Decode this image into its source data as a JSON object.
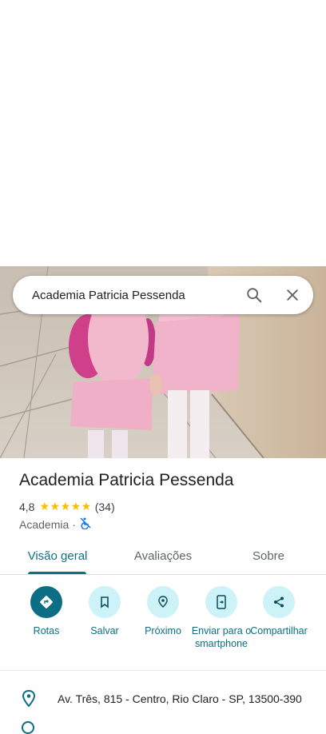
{
  "search": {
    "query": "Academia Patricia Pessenda"
  },
  "place": {
    "name": "Academia Patricia Pessenda",
    "rating": "4,8",
    "stars": "★★★★★",
    "reviews_count": "(34)",
    "category": "Academia",
    "separator": "·"
  },
  "tabs": [
    {
      "label": "Visão geral",
      "active": true
    },
    {
      "label": "Avaliações",
      "active": false
    },
    {
      "label": "Sobre",
      "active": false
    }
  ],
  "actions": [
    {
      "label": "Rotas",
      "icon": "directions-icon"
    },
    {
      "label": "Salvar",
      "icon": "bookmark-icon"
    },
    {
      "label": "Próximo",
      "icon": "nearby-icon"
    },
    {
      "label": "Enviar para o smartphone",
      "icon": "send-to-phone-icon"
    },
    {
      "label": "Compartilhar",
      "icon": "share-icon"
    }
  ],
  "address": {
    "text": "Av. Três, 815 - Centro, Rio Claro - SP, 13500-390"
  },
  "colors": {
    "accent": "#0b6e84",
    "tab_active": "#0b7285",
    "star": "#fbbc04",
    "action_bg": "#cdf2f7"
  }
}
